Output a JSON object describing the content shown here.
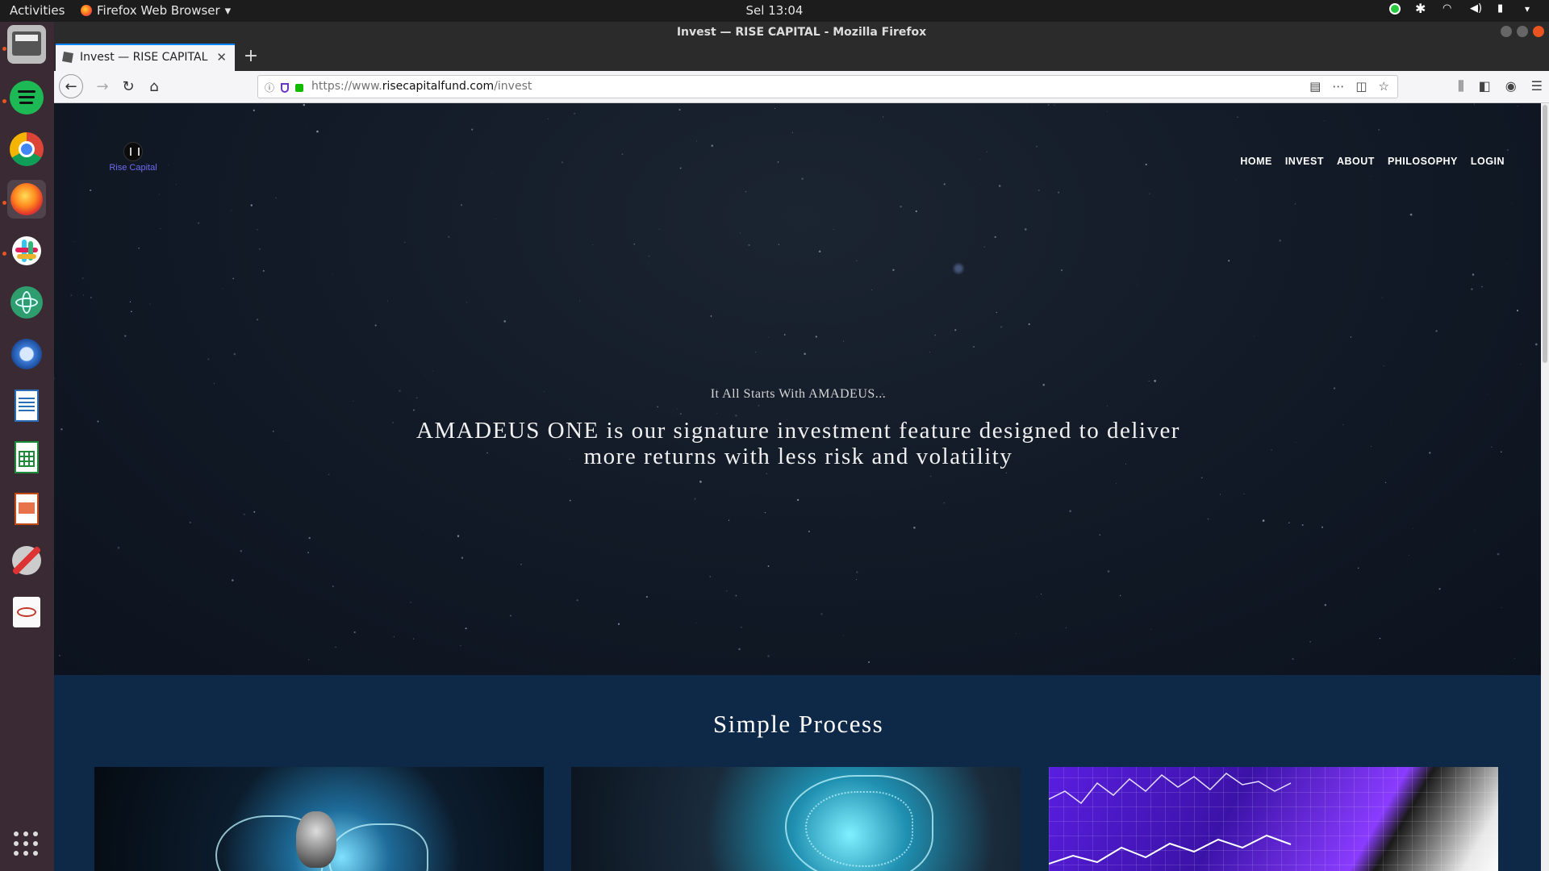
{
  "system": {
    "activities": "Activities",
    "app_menu": "Firefox Web Browser",
    "clock": "Sel 13:04"
  },
  "window": {
    "title": "Invest — RISE CAPITAL - Mozilla Firefox"
  },
  "browser": {
    "tab_title": "Invest — RISE CAPITAL",
    "url_prefix": "https://www.",
    "url_domain": "risecapitalfund.com",
    "url_path": "/invest"
  },
  "dock": {
    "apps": [
      "files",
      "spotify",
      "chrome",
      "firefox",
      "slack",
      "atom",
      "thunderbird",
      "writer",
      "calc",
      "impress",
      "settings",
      "editor"
    ]
  },
  "site": {
    "logo_text": "Rise Capital",
    "nav": [
      "HOME",
      "INVEST",
      "ABOUT",
      "PHILOSOPHY",
      "LOGIN"
    ],
    "hero_sub": "It All Starts With AMADEUS...",
    "hero_headline": "AMADEUS ONE is our signature investment feature designed to deliver more returns with less risk and volatility",
    "process_title": "Simple Process"
  },
  "colors": {
    "accent_tab": "#0a84ff",
    "logo_text": "#6e6bf0",
    "process_bg": "#0e2848"
  }
}
